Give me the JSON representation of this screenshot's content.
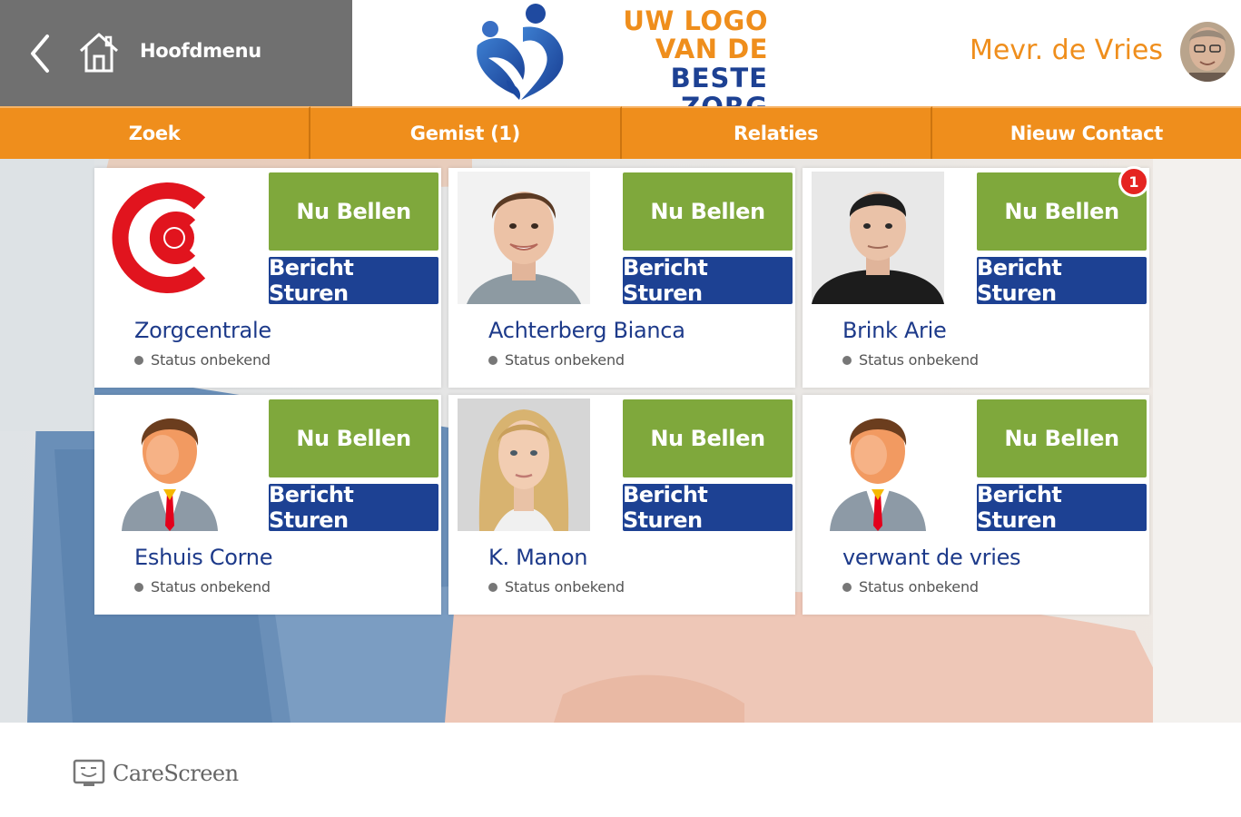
{
  "header": {
    "home_label": "Hoofdmenu",
    "logo": {
      "line1": "UW LOGO",
      "line2": "VAN DE",
      "line3": "BESTE ZORG"
    },
    "user_name": "Mevr. de Vries"
  },
  "tabs": [
    {
      "label": "Zoek"
    },
    {
      "label": "Gemist (1)"
    },
    {
      "label": "Relaties"
    },
    {
      "label": "Nieuw Contact"
    }
  ],
  "contacts": [
    {
      "name": "Zorgcentrale",
      "status": "Status onbekend",
      "call_label": "Nu Bellen",
      "message_label": "Bericht Sturen",
      "photo": "zorgcentrale-logo"
    },
    {
      "name": "Achterberg Bianca",
      "status": "Status onbekend",
      "call_label": "Nu Bellen",
      "message_label": "Bericht Sturen",
      "photo": "woman-short-hair-photo"
    },
    {
      "name": "Brink Arie",
      "status": "Status onbekend",
      "call_label": "Nu Bellen",
      "message_label": "Bericht Sturen",
      "photo": "man-photo",
      "badge": "1"
    },
    {
      "name": "Eshuis Corne",
      "status": "Status onbekend",
      "call_label": "Nu Bellen",
      "message_label": "Bericht Sturen",
      "photo": "default-avatar"
    },
    {
      "name": "K. Manon",
      "status": "Status onbekend",
      "call_label": "Nu Bellen",
      "message_label": "Bericht Sturen",
      "photo": "woman-blonde-photo"
    },
    {
      "name": "verwant de vries",
      "status": "Status onbekend",
      "call_label": "Nu Bellen",
      "message_label": "Bericht Sturen",
      "photo": "default-avatar"
    }
  ],
  "footer": {
    "brand": "CareScreen"
  },
  "colors": {
    "orange": "#ef8e1c",
    "blue": "#1d4193",
    "green": "#7fa83c",
    "gray_header": "#707070",
    "badge_red": "#e52421"
  }
}
